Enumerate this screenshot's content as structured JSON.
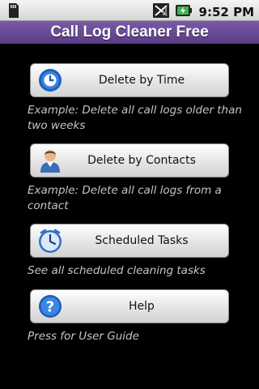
{
  "status_bar": {
    "time": "9:52 PM",
    "icons": [
      "sdcard-icon",
      "no-signal-icon",
      "battery-charging-icon"
    ]
  },
  "app": {
    "title": "Call Log Cleaner Free"
  },
  "actions": [
    {
      "label": "Delete by Time",
      "description": "Example: Delete all call logs older than two weeks",
      "icon": "clock-icon"
    },
    {
      "label": "Delete by Contacts",
      "description": "Example: Delete all call logs from a contact",
      "icon": "contact-person-icon"
    },
    {
      "label": "Scheduled Tasks",
      "description": "See all scheduled cleaning tasks",
      "icon": "scheduled-clock-icon"
    },
    {
      "label": "Help",
      "description": "Press for User Guide",
      "icon": "help-icon"
    }
  ],
  "colors": {
    "title_bar": "#6a4c96",
    "background": "#000000",
    "description_text": "#c4c4c4"
  }
}
